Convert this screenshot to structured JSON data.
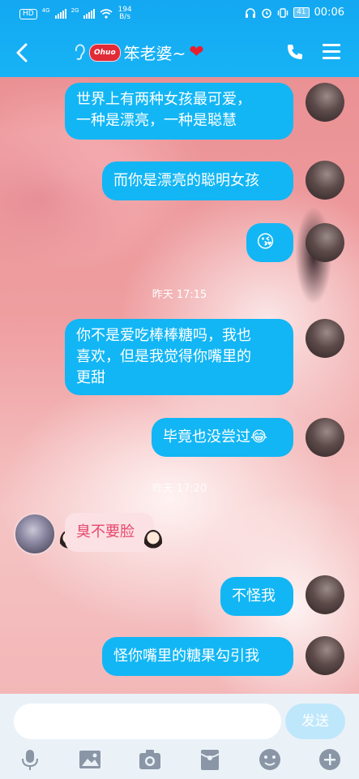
{
  "status_bar": {
    "hd": "HD",
    "net1": "4G",
    "net2": "2G",
    "speed_value": "194",
    "speed_unit": "B/s",
    "battery": "41",
    "time": "00:06"
  },
  "header": {
    "logo_text": "Ohuo",
    "title": "笨老婆~",
    "heart": "❤"
  },
  "messages": [
    {
      "text_line1": "世界上有两种女孩最可爱，",
      "text_line2": "一种是漂亮，一种是聪慧"
    },
    {
      "text": "而你是漂亮的聪明女孩"
    },
    {
      "text": "😘"
    },
    {
      "timestamp": "昨天 17:15"
    },
    {
      "text_line1": "你不是爱吃棒棒糖吗，我也",
      "text_line2": "喜欢，但是我觉得你嘴里的",
      "text_line3": "更甜"
    },
    {
      "text": "毕竟也没尝过😂"
    },
    {
      "timestamp": "昨天 17:20"
    },
    {
      "text": "臭不要脸"
    },
    {
      "text": "不怪我"
    },
    {
      "text": "怪你嘴里的糖果勾引我"
    }
  ],
  "input": {
    "placeholder": "",
    "send_label": "发送"
  },
  "toolbar": {
    "icons": [
      "microphone-icon",
      "image-icon",
      "camera-icon",
      "red-packet-icon",
      "emoji-icon",
      "plus-icon"
    ]
  },
  "colors": {
    "header_blue": "#17b3f6",
    "bubble_blue": "#12b6f5",
    "pink_bubble": "#fbe1e4",
    "pink_text": "#e7486c",
    "heart_red": "#e81f2d"
  }
}
